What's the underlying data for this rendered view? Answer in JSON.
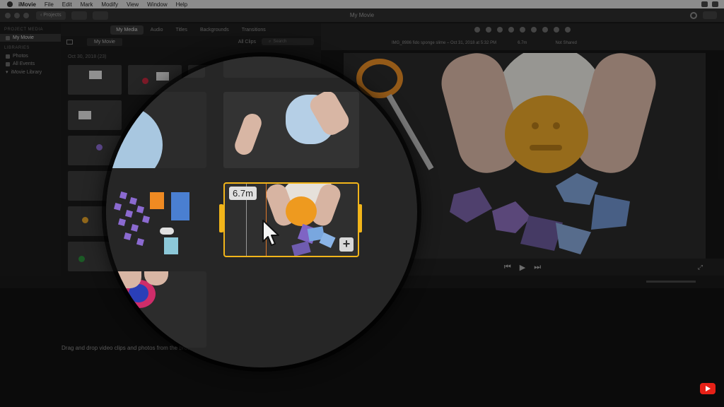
{
  "menubar": {
    "app": "iMovie",
    "items": [
      "File",
      "Edit",
      "Mark",
      "Modify",
      "View",
      "Window",
      "Help"
    ]
  },
  "window": {
    "title": "My Movie",
    "projects_button": "Projects"
  },
  "sidebar": {
    "project_media_header": "PROJECT MEDIA",
    "project_item": "My Movie",
    "libraries_header": "LIBRARIES",
    "library_items": [
      "Photos",
      "All Events",
      "iMovie Library"
    ]
  },
  "browser": {
    "tabs": [
      "My Media",
      "Audio",
      "Titles",
      "Backgrounds",
      "Transitions"
    ],
    "active_tab": "My Media",
    "project_label": "My Movie",
    "clips_filter": "All Clips",
    "search_placeholder": "Search",
    "date_header": "Oct 30, 2018  (23)"
  },
  "viewer": {
    "clip_name": "IMG_8986 fido sponge slime – Oct 31, 2018 at 5:32 PM",
    "duration": "6.7m",
    "shared_status": "Not Shared"
  },
  "magnifier": {
    "duration_badge": "6.7m",
    "add_button": "+"
  },
  "timeline": {
    "hint": "Drag and drop video clips and photos from the browser above to start creating your movie."
  },
  "colors": {
    "selection": "#f2b51a",
    "background": "#151515"
  },
  "icons": [
    "apple-icon",
    "search-icon",
    "play-icon",
    "skip-back-icon",
    "skip-forward-icon",
    "fullscreen-icon",
    "plus-icon",
    "cursor-arrow-icon",
    "youtube-icon"
  ]
}
